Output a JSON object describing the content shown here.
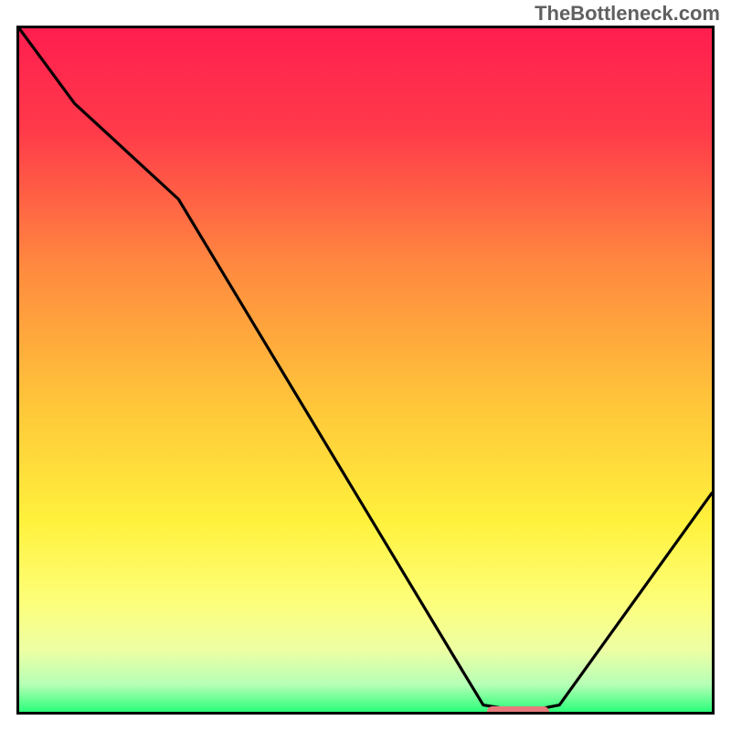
{
  "attribution": "TheBottleneck.com",
  "chart_data": {
    "type": "line",
    "title": "",
    "xlabel": "",
    "ylabel": "",
    "xlim": [
      0,
      100
    ],
    "ylim": [
      0,
      100
    ],
    "x": [
      0,
      8,
      23,
      64,
      67,
      73,
      78,
      100
    ],
    "values": [
      100,
      89,
      75,
      6,
      1,
      0,
      1,
      32
    ],
    "optimum_marker": {
      "x_center": 72,
      "width_pct": 9,
      "y": 0
    },
    "gradient_stops": [
      {
        "pct": 0,
        "color": "#ff1e4f"
      },
      {
        "pct": 15,
        "color": "#ff3a4a"
      },
      {
        "pct": 35,
        "color": "#ff8a3f"
      },
      {
        "pct": 55,
        "color": "#ffc63a"
      },
      {
        "pct": 72,
        "color": "#fff13c"
      },
      {
        "pct": 84,
        "color": "#fdff7a"
      },
      {
        "pct": 91,
        "color": "#edffa4"
      },
      {
        "pct": 96,
        "color": "#b6ffb6"
      },
      {
        "pct": 100,
        "color": "#2bff7a"
      }
    ]
  }
}
